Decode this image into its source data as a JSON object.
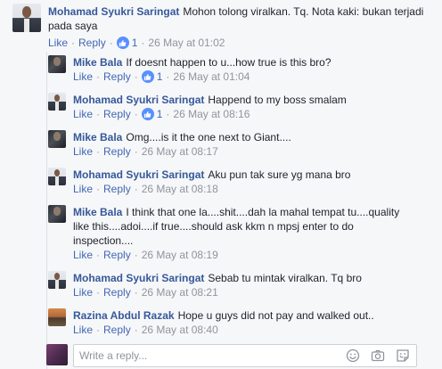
{
  "thread": {
    "top_comment": {
      "author": "Mohamad Syukri Saringat",
      "text": "Mohon tolong viralkan. Tq. Nota kaki: bukan terjadi pada saya",
      "like_label": "Like",
      "reply_label": "Reply",
      "likes": "1",
      "time": "26 May at 01:02",
      "avatar_icon": "avatar-syukri"
    },
    "replies": [
      {
        "author": "Mike Bala",
        "text": "If doesnt happen to u...how true is this bro?",
        "like_label": "Like",
        "reply_label": "Reply",
        "likes": "1",
        "time": "26 May at 01:04"
      },
      {
        "author": "Mohamad Syukri Saringat",
        "text": "Happend to my boss smalam",
        "like_label": "Like",
        "reply_label": "Reply",
        "likes": "1",
        "time": "26 May at 08:16"
      },
      {
        "author": "Mike Bala",
        "text": "Omg....is it the one next to Giant....",
        "like_label": "Like",
        "reply_label": "Reply",
        "likes": "",
        "time": "26 May at 08:17"
      },
      {
        "author": "Mohamad Syukri Saringat",
        "text": "Aku pun tak sure yg mana bro",
        "like_label": "Like",
        "reply_label": "Reply",
        "likes": "",
        "time": "26 May at 08:18"
      },
      {
        "author": "Mike Bala",
        "text": "I think that one la....shit....dah la mahal tempat tu....quality like this....adoi....if true....should ask kkm n mpsj enter to do inspection....",
        "like_label": "Like",
        "reply_label": "Reply",
        "likes": "",
        "time": "26 May at 08:19"
      },
      {
        "author": "Mohamad Syukri Saringat",
        "text": "Sebab tu mintak viralkan. Tq bro",
        "like_label": "Like",
        "reply_label": "Reply",
        "likes": "",
        "time": "26 May at 08:21"
      },
      {
        "author": "Razina Abdul Razak",
        "text": "Hope u guys did not pay and walked out..",
        "like_label": "Like",
        "reply_label": "Reply",
        "likes": "",
        "time": "26 May at 08:40"
      }
    ],
    "reply_input": {
      "placeholder": "Write a reply...",
      "value": ""
    }
  },
  "colors": {
    "name_blue": "#365899",
    "link_blue": "#4267b2",
    "meta_grey": "#90949c",
    "like_badge": "#5890ff",
    "background": "#f6f7f9"
  },
  "icons": [
    "like-thumb-icon",
    "emoji-icon",
    "camera-icon",
    "sticker-icon"
  ]
}
